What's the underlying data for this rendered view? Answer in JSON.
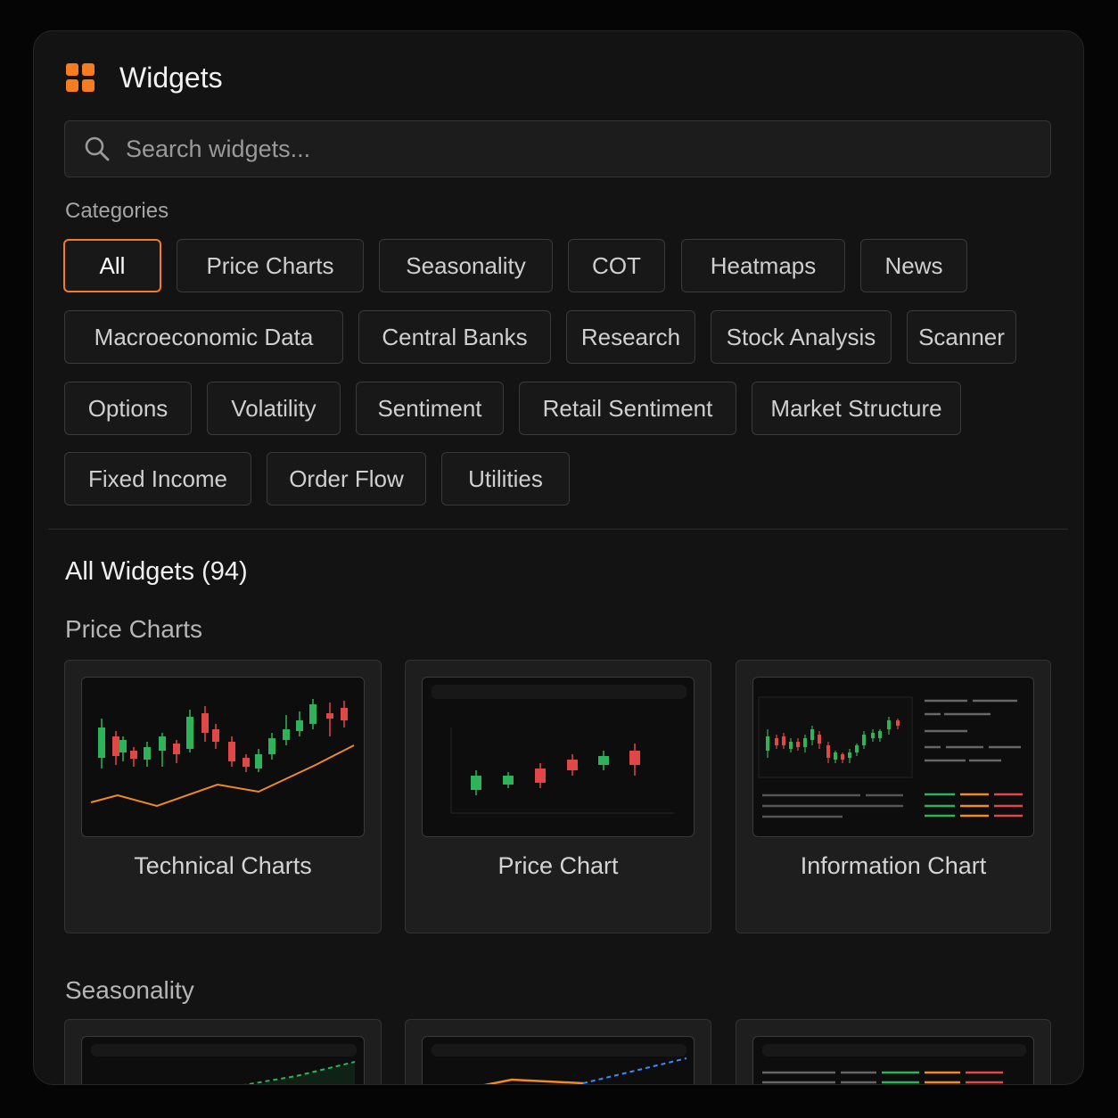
{
  "header": {
    "title": "Widgets",
    "logo_icon": "grid-icon",
    "accent": "#f57c1f"
  },
  "search": {
    "placeholder": "Search widgets...",
    "value": ""
  },
  "categories": {
    "label": "Categories",
    "items": [
      {
        "label": "All",
        "active": true
      },
      {
        "label": "Price Charts"
      },
      {
        "label": "Seasonality"
      },
      {
        "label": "COT"
      },
      {
        "label": "Heatmaps"
      },
      {
        "label": "News"
      },
      {
        "label": "Macroeconomic Data"
      },
      {
        "label": "Central Banks"
      },
      {
        "label": "Research"
      },
      {
        "label": "Stock Analysis"
      },
      {
        "label": "Scanner"
      },
      {
        "label": "Options"
      },
      {
        "label": "Volatility"
      },
      {
        "label": "Sentiment"
      },
      {
        "label": "Retail Sentiment"
      },
      {
        "label": "Market Structure"
      },
      {
        "label": "Fixed Income"
      },
      {
        "label": "Order Flow"
      },
      {
        "label": "Utilities"
      }
    ]
  },
  "widgets": {
    "title": "All Widgets (94)",
    "groups": [
      {
        "title": "Price Charts",
        "cards": [
          {
            "label": "Technical Charts"
          },
          {
            "label": "Price Chart"
          },
          {
            "label": "Information Chart"
          }
        ]
      },
      {
        "title": "Seasonality",
        "cards": []
      }
    ]
  },
  "colors": {
    "up": "#2fb35a",
    "down": "#e04848",
    "line": "#f08a24",
    "dashed_blue": "#3a8bff"
  }
}
